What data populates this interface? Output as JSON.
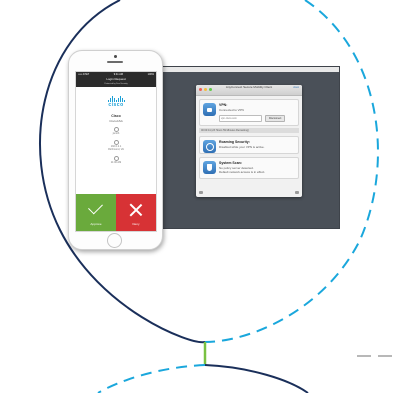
{
  "colors": {
    "circle_outline": "#1a2f5a",
    "dashed_accent": "#1aa7dc",
    "connector": "#79c142",
    "approve_green": "#6aaa3c",
    "deny_red": "#d73235",
    "cisco_blue": "#1ba0d7"
  },
  "icons": [
    "lock-icon",
    "globe-icon",
    "shield-icon",
    "check-icon",
    "x-icon",
    "cisco-logo"
  ],
  "phone": {
    "status_left": "••••• AT&T",
    "status_time": "9:41 AM",
    "status_right": "100%",
    "nav_title": "Login Request",
    "nav_sub": "Protected by Duo Security",
    "brand": "cisco",
    "org": "Cisco",
    "org_sub": "CiscoASA",
    "info": [
      "jsmith",
      "192.0.2.1",
      "Richmond, VA",
      "11:00 AM"
    ],
    "approve_label": "Approve",
    "deny_label": "Deny"
  },
  "anyconnect": {
    "title": "AnyConnect Secure Mobility Client",
    "title_link": "cisco",
    "vpn": {
      "heading": "VPN:",
      "status": "Connected to VPN",
      "server": "vpn.cisco.com",
      "button": "Disconnect"
    },
    "stats": "00:00:41 (23 Hours 59 Minutes Remaining)",
    "roaming": {
      "heading": "Roaming Security:",
      "status": "Disabled while your VPN is active."
    },
    "system": {
      "heading": "System Scan:",
      "line1": "No policy server detected.",
      "line2": "Default network access is in effect."
    }
  }
}
